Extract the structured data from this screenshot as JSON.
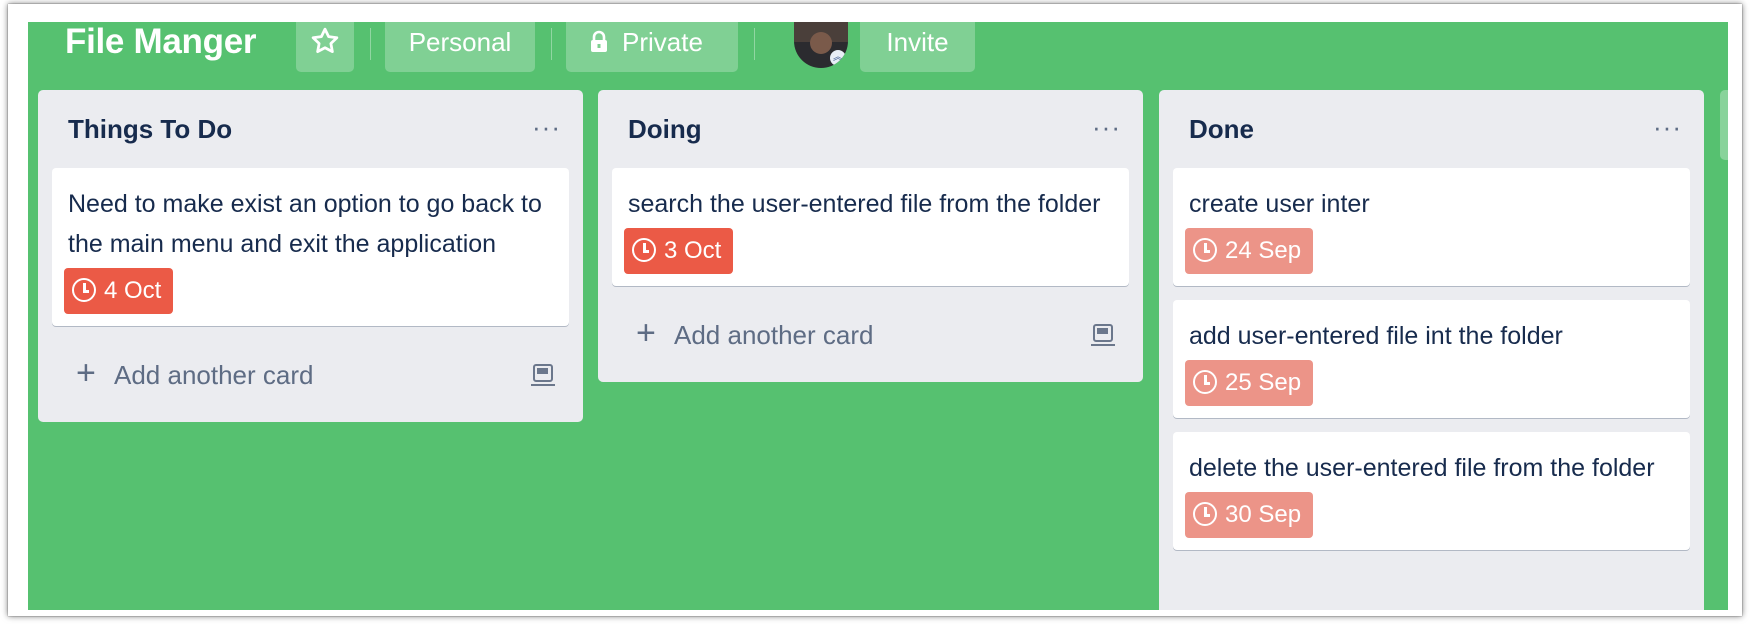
{
  "board": {
    "title": "File Manger",
    "star_icon": "star-icon",
    "visibility_team": "Personal",
    "visibility_privacy": "Private",
    "lock_icon": "lock-icon",
    "invite_label": "Invite",
    "background_color": "#56c170"
  },
  "lists": [
    {
      "title": "Things To Do",
      "menu": "···",
      "cards": [
        {
          "text": "Need to make exist an option to go back to the main menu and exit the application",
          "due": "4 Oct",
          "due_status": "overdue"
        }
      ],
      "add_card_label": "Add another card"
    },
    {
      "title": "Doing",
      "menu": "···",
      "cards": [
        {
          "text": "search the user-entered file from the folder",
          "due": "3 Oct",
          "due_status": "overdue"
        }
      ],
      "add_card_label": "Add another card"
    },
    {
      "title": "Done",
      "menu": "···",
      "cards": [
        {
          "text": "create user inter",
          "due": "24 Sep",
          "due_status": "past"
        },
        {
          "text": "add user-entered file int the folder",
          "due": "25 Sep",
          "due_status": "past"
        },
        {
          "text": "delete the user-entered file from the folder",
          "due": "30 Sep",
          "due_status": "past"
        }
      ]
    }
  ],
  "colors": {
    "due_overdue": "#eb5a46",
    "due_past": "#ec9488",
    "list_bg": "#ebecf0"
  }
}
